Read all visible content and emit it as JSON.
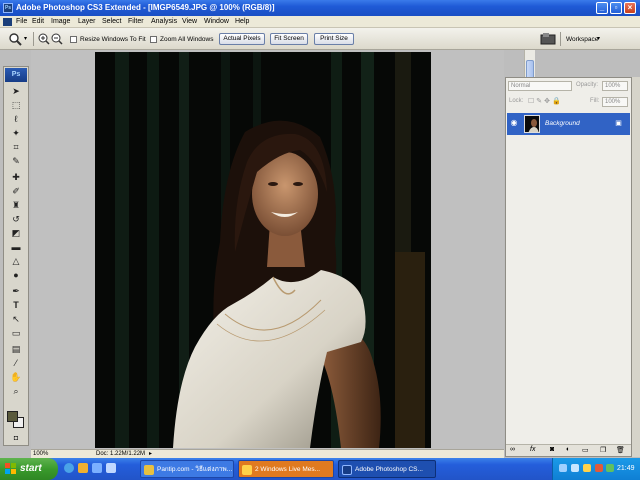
{
  "window": {
    "title": "Adobe Photoshop CS3 Extended - [IMGP6549.JPG @ 100% (RGB/8)]",
    "app_icon": "ps-app-icon",
    "buttons": [
      "minimize",
      "restore",
      "close"
    ]
  },
  "menubar": {
    "items": [
      "File",
      "Edit",
      "Image",
      "Layer",
      "Select",
      "Filter",
      "Analysis",
      "View",
      "Window",
      "Help"
    ]
  },
  "options": {
    "tool_icon": "zoom-icon",
    "resize_windows_label": "Resize Windows To Fit",
    "zoom_all_windows_label": "Zoom All Windows",
    "actual_pixels_label": "Actual Pixels",
    "fit_screen_label": "Fit Screen",
    "print_size_label": "Print Size",
    "workspace_label": "Workspace"
  },
  "toolbox": {
    "logo": "Ps",
    "tools": [
      "move-tool-icon",
      "marquee-tool-icon",
      "lasso-tool-icon",
      "magic-wand-icon",
      "crop-tool-icon",
      "slice-tool-icon",
      "healing-brush-icon",
      "brush-tool-icon",
      "clone-stamp-icon",
      "history-brush-icon",
      "eraser-icon",
      "gradient-tool-icon",
      "blur-tool-icon",
      "dodge-tool-icon",
      "pen-tool-icon",
      "type-tool-icon",
      "path-selection-icon",
      "shape-tool-icon",
      "notes-tool-icon",
      "eyedropper-icon",
      "hand-tool-icon",
      "zoom-tool-icon"
    ],
    "foreground_color": "#5a5a3c",
    "background_color": "#f0f0f0"
  },
  "document": {
    "zoom": "100%",
    "doc_size": "Doc: 1.22M/1.22M"
  },
  "layers_panel": {
    "blend_mode": "Normal",
    "opacity_label": "Opacity:",
    "opacity_value": "100%",
    "lock_label": "Lock:",
    "fill_label": "Fill:",
    "fill_value": "100%",
    "layer_name": "Background"
  },
  "taskbar": {
    "start_label": "start",
    "tasks": [
      {
        "label": "Pantip.com - วิธีแต่งภาพ...",
        "active": false,
        "color": "#3d7ae4"
      },
      {
        "label": "2 Windows Live Mes...",
        "active": false,
        "color": "#e07a20"
      },
      {
        "label": "Adobe Photoshop CS...",
        "active": true,
        "color": "#1e4fb0"
      }
    ],
    "clock": "21:49"
  }
}
